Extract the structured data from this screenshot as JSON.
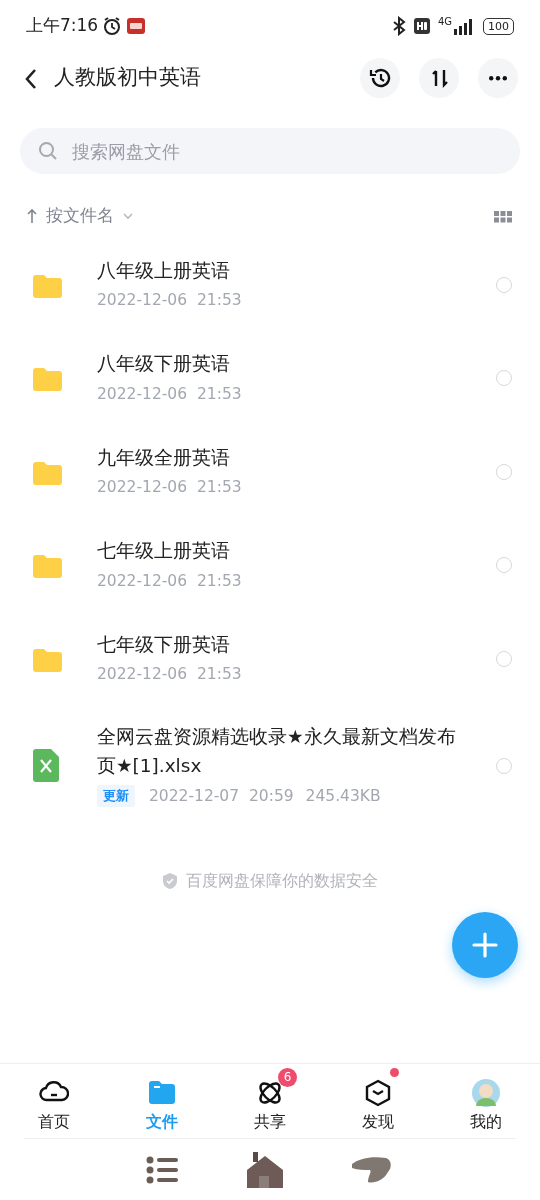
{
  "status_bar": {
    "time": "上午7:16",
    "network": "4G",
    "battery": "100"
  },
  "header": {
    "title": "人教版初中英语"
  },
  "search": {
    "placeholder": "搜索网盘文件"
  },
  "sort": {
    "label": "按文件名"
  },
  "files": [
    {
      "kind": "folder",
      "name": "八年级上册英语",
      "date": "2022-12-06",
      "time": "21:53",
      "selected": false
    },
    {
      "kind": "folder",
      "name": "八年级下册英语",
      "date": "2022-12-06",
      "time": "21:53",
      "selected": false
    },
    {
      "kind": "folder",
      "name": "九年级全册英语",
      "date": "2022-12-06",
      "time": "21:53",
      "selected": false
    },
    {
      "kind": "folder",
      "name": "七年级上册英语",
      "date": "2022-12-06",
      "time": "21:53",
      "selected": false
    },
    {
      "kind": "folder",
      "name": "七年级下册英语",
      "date": "2022-12-06",
      "time": "21:53",
      "selected": false
    },
    {
      "kind": "sheet",
      "name": "全网云盘资源精选收录★永久最新文档发布页★[1].xlsx",
      "tag": "更新",
      "date": "2022-12-07",
      "time": "20:59",
      "size": "245.43KB",
      "selected": false
    }
  ],
  "footer_note": "百度网盘保障你的数据安全",
  "tabs": [
    {
      "kind": "home",
      "label": "首页",
      "selected": false
    },
    {
      "kind": "files",
      "label": "文件",
      "selected": true
    },
    {
      "kind": "share",
      "label": "共享",
      "badge": "6",
      "selected": false
    },
    {
      "kind": "discover",
      "label": "发现",
      "dot": true,
      "selected": false
    },
    {
      "kind": "me",
      "label": "我的",
      "selected": false
    }
  ]
}
